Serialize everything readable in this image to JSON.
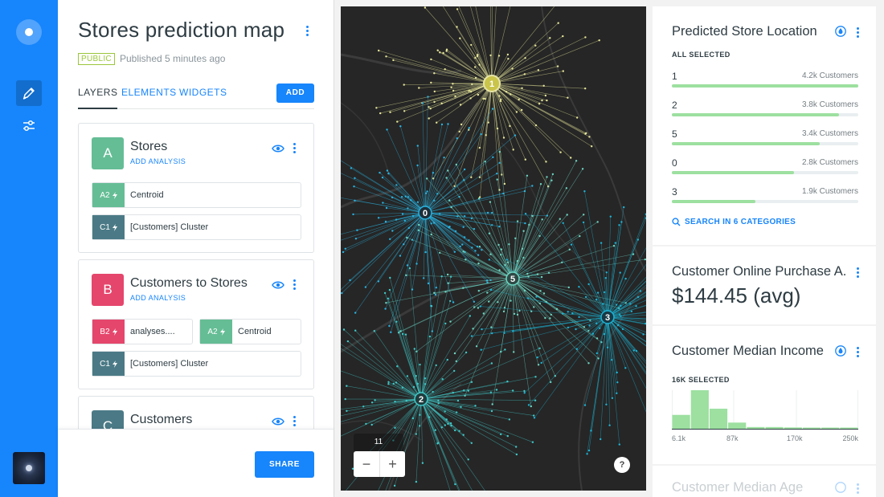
{
  "sidebar": {
    "items": [
      {
        "name": "edit-pencil-icon",
        "active": true
      },
      {
        "name": "sliders-icon",
        "active": false
      }
    ]
  },
  "editor": {
    "title": "Stores prediction map",
    "visibility_badge": "PUBLIC",
    "published": "Published 5 minutes ago",
    "tabs": [
      {
        "label": "LAYERS",
        "active": true
      },
      {
        "label": "ELEMENTS",
        "active": false
      },
      {
        "label": "WIDGETS",
        "active": false
      }
    ],
    "add_label": "ADD",
    "layers": [
      {
        "letter": "A",
        "name": "Stores",
        "add_analysis": "ADD ANALYSIS",
        "color": "#65bd95",
        "nodes": [
          {
            "id": "A2",
            "label": "Centroid",
            "color": "#65bd95"
          },
          {
            "id": "C1",
            "label": "[Customers] Cluster",
            "color": "#4b7a86"
          }
        ]
      },
      {
        "letter": "B",
        "name": "Customers to Stores",
        "add_analysis": "ADD ANALYSIS",
        "color": "#e5466c",
        "nodes": [
          {
            "id": "B2",
            "label": "analyses....",
            "color": "#e5466c"
          },
          {
            "id": "A2",
            "label": "Centroid",
            "color": "#65bd95"
          },
          {
            "id": "C1",
            "label": "[Customers] Cluster",
            "color": "#4b7a86"
          }
        ]
      },
      {
        "letter": "C",
        "name": "Customers",
        "color": "#4b7a86"
      }
    ],
    "share_label": "SHARE"
  },
  "map": {
    "zoom_level": "11",
    "zoom_in": "+",
    "zoom_out": "−",
    "help": "?",
    "clusters": [
      {
        "label": "1",
        "color": "#e6e69a"
      },
      {
        "label": "0",
        "color": "#2ab3e0"
      },
      {
        "label": "5",
        "color": "#6ed6c2"
      },
      {
        "label": "3",
        "color": "#1cb4d6"
      },
      {
        "label": "2",
        "color": "#41c9c9"
      }
    ]
  },
  "widgets": {
    "predicted_location": {
      "title": "Predicted Store Location",
      "subtitle": "ALL SELECTED",
      "categories": [
        {
          "name": "1",
          "value": "4.2k Customers",
          "fraction": 1.0
        },
        {
          "name": "2",
          "value": "3.8k Customers",
          "fraction": 0.895
        },
        {
          "name": "5",
          "value": "3.4k Customers",
          "fraction": 0.795
        },
        {
          "name": "0",
          "value": "2.8k Customers",
          "fraction": 0.655
        },
        {
          "name": "3",
          "value": "1.9k Customers",
          "fraction": 0.45
        }
      ],
      "search": "SEARCH IN 6 CATEGORIES"
    },
    "online_purchase": {
      "title": "Customer Online Purchase A...",
      "value": "$144.45 (avg)"
    },
    "median_income": {
      "title": "Customer Median Income",
      "subtitle": "16K SELECTED",
      "axis_labels": [
        "6.1k",
        "87k",
        "170k",
        "250k"
      ]
    },
    "median_age": {
      "title": "Customer Median Age"
    }
  },
  "chart_data": {
    "type": "bar",
    "title": "Customer Median Income",
    "xlabel": "",
    "ylabel": "",
    "tick_labels": [
      "6.1k",
      "87k",
      "170k",
      "250k"
    ],
    "values": [
      0.36,
      1.0,
      0.52,
      0.16,
      0.045,
      0.045,
      0.035,
      0.03,
      0.03,
      0.03
    ]
  },
  "colors": {
    "accent": "#1785fb",
    "bar_green": "#9de0a0",
    "map_bg": "#262626"
  }
}
